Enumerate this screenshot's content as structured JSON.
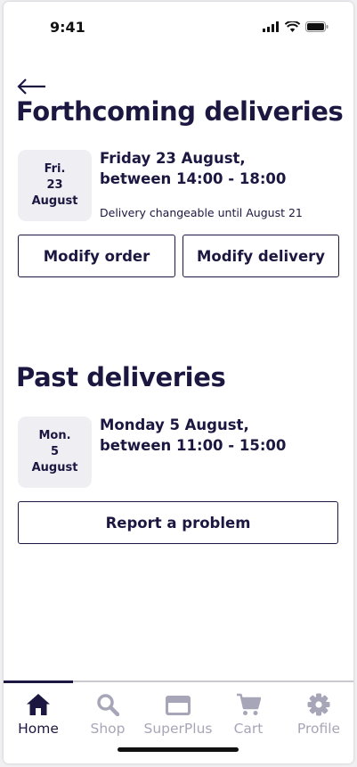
{
  "status_bar": {
    "time": "9:41"
  },
  "page": {
    "title": "Forthcoming deliveries"
  },
  "forthcoming": [
    {
      "day_abbr": "Fri.",
      "day_num": "23",
      "month": "August",
      "title_line1": "Friday 23 August,",
      "title_line2": "between 14:00 - 18:00",
      "note": "Delivery changeable until August 21",
      "actions": {
        "modify_order": "Modify order",
        "modify_delivery": "Modify delivery"
      }
    }
  ],
  "past_section": {
    "title": "Past deliveries"
  },
  "past": [
    {
      "day_abbr": "Mon.",
      "day_num": "5",
      "month": "August",
      "title_line1": "Monday 5 August,",
      "title_line2": "between 11:00 - 15:00",
      "actions": {
        "report_problem": "Report a problem"
      }
    }
  ],
  "tabbar": {
    "items": [
      {
        "label": "Home",
        "icon": "home-icon",
        "active": true
      },
      {
        "label": "Shop",
        "icon": "search-icon",
        "active": false
      },
      {
        "label": "SuperPlus",
        "icon": "card-icon",
        "active": false
      },
      {
        "label": "Cart",
        "icon": "cart-icon",
        "active": false
      },
      {
        "label": "Profile",
        "icon": "gear-icon",
        "active": false
      }
    ]
  },
  "colors": {
    "primary": "#1c1740",
    "inactive": "#a7a6b8",
    "date_bg": "#efeff3"
  }
}
